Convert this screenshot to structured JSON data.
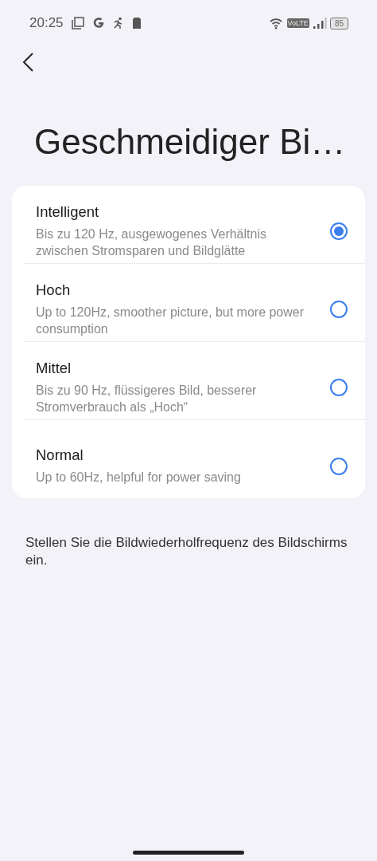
{
  "status_bar": {
    "time": "20:25",
    "network_badge": "VoLTE",
    "battery": "85"
  },
  "title": "Geschmeidiger Bi…",
  "options": [
    {
      "label": "Intelligent",
      "description": "Bis zu 120 Hz, ausgewogenes Verhältnis zwischen Stromsparen und Bildglätte",
      "selected": true
    },
    {
      "label": "Hoch",
      "description": "Up to 120Hz, smoother picture, but more power consumption",
      "selected": false
    },
    {
      "label": "Mittel",
      "description": "Bis zu 90 Hz, flüssigeres Bild, besserer Stromverbrauch als „Hoch“",
      "selected": false
    },
    {
      "label": "Normal",
      "description": "Up to 60Hz, helpful for power saving",
      "selected": false
    }
  ],
  "footer": "Stellen Sie die Bildwiederholfrequenz des Bildschirms ein."
}
